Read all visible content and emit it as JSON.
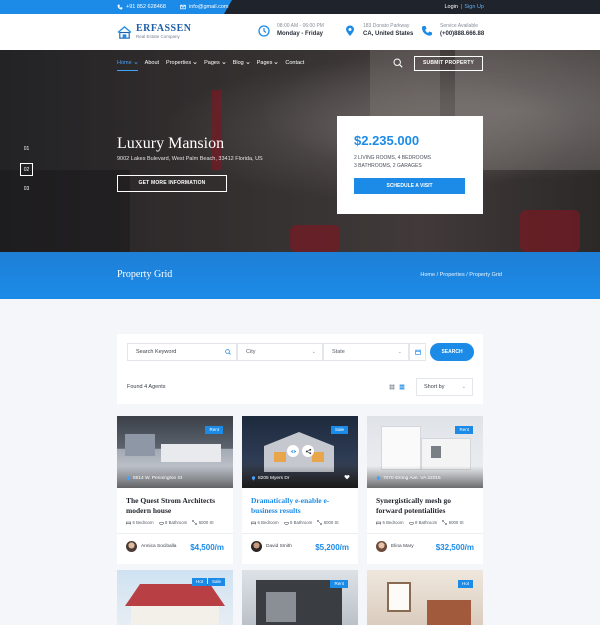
{
  "topbar": {
    "phone": "+91 852 628468",
    "email": "info@gmail.com",
    "login": "Login",
    "separator": "|",
    "signup": "Sign Up"
  },
  "header": {
    "logo_name": "ERFASSEN",
    "logo_tagline": "Real Estate Company",
    "hours_line1": "08:00 AM - 06:00 PM",
    "hours_line2": "Monday - Friday",
    "address_line1": "183 Donato Parkway",
    "address_line2": "CA, United States",
    "service_line1": "Service Available",
    "service_line2": "(+00)888.666.88"
  },
  "nav": {
    "items": [
      {
        "label": "Home",
        "dropdown": true,
        "active": true
      },
      {
        "label": "About",
        "dropdown": false,
        "active": false
      },
      {
        "label": "Properties",
        "dropdown": true,
        "active": false
      },
      {
        "label": "Pages",
        "dropdown": true,
        "active": false
      },
      {
        "label": "Blog",
        "dropdown": true,
        "active": false
      },
      {
        "label": "Pages",
        "dropdown": true,
        "active": false
      },
      {
        "label": "Contact",
        "dropdown": false,
        "active": false
      }
    ],
    "submit_label": "SUBMIT PROPERTY"
  },
  "hero": {
    "slides": [
      "01",
      "02",
      "03"
    ],
    "active_slide": "02",
    "title": "Luxury Mansion",
    "address": "9002 Lakes Bulevard, West Palm Beach, 33412 Florida, US",
    "more_label": "GET MORE INFORMATION",
    "price": "$2.235.000",
    "features_line1": "2 LIVING ROOMS, 4 BEDROOMS",
    "features_line2": "3 BATHROOMS, 2 GARAGES",
    "schedule_label": "SCHEDULE A VISIT"
  },
  "banner": {
    "title": "Property Grid",
    "breadcrumb": "Home / Properties / Property Grid"
  },
  "filter": {
    "search_placeholder": "Search Keyword",
    "city_label": "City",
    "state_label": "State",
    "search_button": "SEARCH",
    "found_text": "Found 4 Agents",
    "sort_label": "Short by"
  },
  "cards": [
    {
      "badge": "Rent",
      "address": "8514 W. Pennington St",
      "title": "The Quest Strom Architects modern house",
      "title_blue": false,
      "beds": "6 Bedroom",
      "baths": "8 Bathroom",
      "area": "6000 St",
      "agent": "Annica Sociballa",
      "price": "$4,500/m"
    },
    {
      "badge": "Sale",
      "address": "8205 Myers Dr",
      "title": "Dramatically e-enable e-business results",
      "title_blue": true,
      "beds": "6 Bedroom",
      "baths": "8 Bathroom",
      "area": "6000 St",
      "agent": "David Smith",
      "price": "$5,200/m"
    },
    {
      "badge": "Rent",
      "address": "7070 strong Ave. VA 22015",
      "title": "Synergistically mesh go forward potentialities",
      "title_blue": false,
      "beds": "6 Bedroom",
      "baths": "8 Bathroom",
      "area": "6000 St",
      "agent": "Elina Mary",
      "price": "$32,500/m"
    }
  ],
  "cards_row2": [
    {
      "badges": [
        "Hot",
        "Sale"
      ]
    },
    {
      "badges": [
        "Rent"
      ]
    },
    {
      "badges": [
        "Hot"
      ]
    }
  ],
  "colors": {
    "accent": "#1c8be8",
    "dark": "#1f232b",
    "page_bg": "#f4f6f9"
  }
}
